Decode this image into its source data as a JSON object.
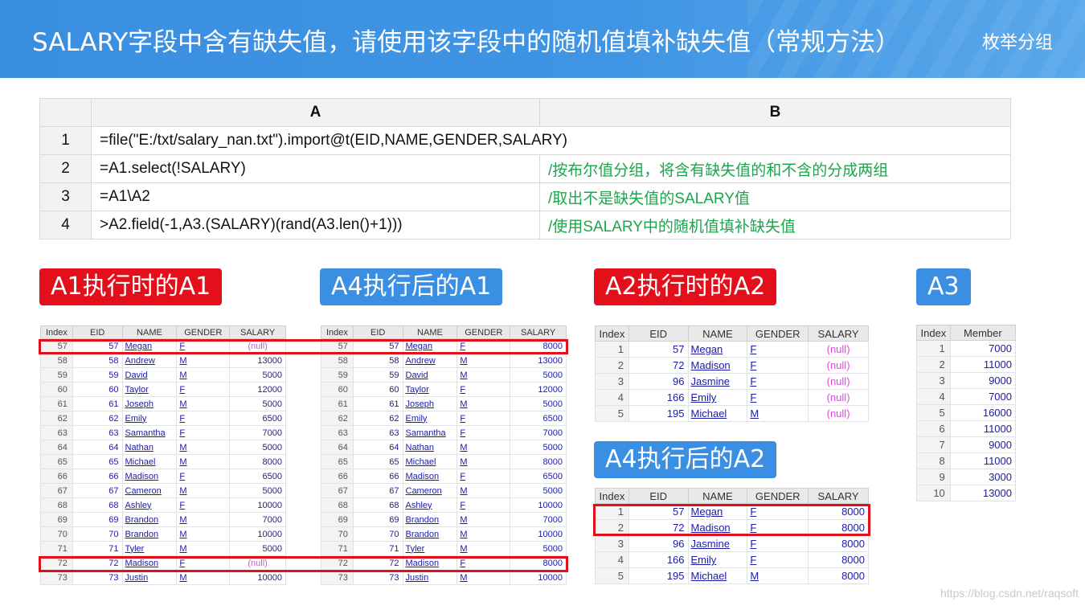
{
  "header": {
    "title": "SALARY字段中含有缺失值，请使用该字段中的随机值填补缺失值（常规方法）",
    "tag": "枚举分组"
  },
  "code_table": {
    "col_a": "A",
    "col_b": "B",
    "rows": [
      {
        "n": "1",
        "a": "=file(\"E:/txt/salary_nan.txt\").import@t(EID,NAME,GENDER,SALARY)",
        "b": ""
      },
      {
        "n": "2",
        "a": "=A1.select(!SALARY)",
        "b": "/按布尔值分组，将含有缺失值的和不含的分成两组"
      },
      {
        "n": "3",
        "a": "=A1\\A2",
        "b": "/取出不是缺失值的SALARY值"
      },
      {
        "n": "4",
        "a": ">A2.field(-1,A3.(SALARY)(rand(A3.len()+1)))",
        "b": "/使用SALARY中的随机值填补缺失值"
      }
    ]
  },
  "labels": {
    "a1_exec": "A1执行时的A1",
    "a4_after_a1": "A4执行后的A1",
    "a2_exec": "A2执行时的A2",
    "a3": "A3",
    "a4_after_a2": "A4执行后的A2"
  },
  "columns": {
    "index": "Index",
    "eid": "EID",
    "name": "NAME",
    "gender": "GENDER",
    "salary": "SALARY",
    "member": "Member"
  },
  "table_a1_before": [
    [
      "57",
      "57",
      "Megan",
      "F",
      "(null)"
    ],
    [
      "58",
      "58",
      "Andrew",
      "M",
      "13000"
    ],
    [
      "59",
      "59",
      "David",
      "M",
      "5000"
    ],
    [
      "60",
      "60",
      "Taylor",
      "F",
      "12000"
    ],
    [
      "61",
      "61",
      "Joseph",
      "M",
      "5000"
    ],
    [
      "62",
      "62",
      "Emily",
      "F",
      "6500"
    ],
    [
      "63",
      "63",
      "Samantha",
      "F",
      "7000"
    ],
    [
      "64",
      "64",
      "Nathan",
      "M",
      "5000"
    ],
    [
      "65",
      "65",
      "Michael",
      "M",
      "8000"
    ],
    [
      "66",
      "66",
      "Madison",
      "F",
      "6500"
    ],
    [
      "67",
      "67",
      "Cameron",
      "M",
      "5000"
    ],
    [
      "68",
      "68",
      "Ashley",
      "F",
      "10000"
    ],
    [
      "69",
      "69",
      "Brandon",
      "M",
      "7000"
    ],
    [
      "70",
      "70",
      "Brandon",
      "M",
      "10000"
    ],
    [
      "71",
      "71",
      "Tyler",
      "M",
      "5000"
    ],
    [
      "72",
      "72",
      "Madison",
      "F",
      "(null)"
    ],
    [
      "73",
      "73",
      "Justin",
      "M",
      "10000"
    ]
  ],
  "table_a1_after": [
    [
      "57",
      "57",
      "Megan",
      "F",
      "8000"
    ],
    [
      "58",
      "58",
      "Andrew",
      "M",
      "13000"
    ],
    [
      "59",
      "59",
      "David",
      "M",
      "5000"
    ],
    [
      "60",
      "60",
      "Taylor",
      "F",
      "12000"
    ],
    [
      "61",
      "61",
      "Joseph",
      "M",
      "5000"
    ],
    [
      "62",
      "62",
      "Emily",
      "F",
      "6500"
    ],
    [
      "63",
      "63",
      "Samantha",
      "F",
      "7000"
    ],
    [
      "64",
      "64",
      "Nathan",
      "M",
      "5000"
    ],
    [
      "65",
      "65",
      "Michael",
      "M",
      "8000"
    ],
    [
      "66",
      "66",
      "Madison",
      "F",
      "6500"
    ],
    [
      "67",
      "67",
      "Cameron",
      "M",
      "5000"
    ],
    [
      "68",
      "68",
      "Ashley",
      "F",
      "10000"
    ],
    [
      "69",
      "69",
      "Brandon",
      "M",
      "7000"
    ],
    [
      "70",
      "70",
      "Brandon",
      "M",
      "10000"
    ],
    [
      "71",
      "71",
      "Tyler",
      "M",
      "5000"
    ],
    [
      "72",
      "72",
      "Madison",
      "F",
      "8000"
    ],
    [
      "73",
      "73",
      "Justin",
      "M",
      "10000"
    ]
  ],
  "table_a2_before": [
    [
      "1",
      "57",
      "Megan",
      "F",
      "(null)"
    ],
    [
      "2",
      "72",
      "Madison",
      "F",
      "(null)"
    ],
    [
      "3",
      "96",
      "Jasmine",
      "F",
      "(null)"
    ],
    [
      "4",
      "166",
      "Emily",
      "F",
      "(null)"
    ],
    [
      "5",
      "195",
      "Michael",
      "M",
      "(null)"
    ]
  ],
  "table_a2_after": [
    [
      "1",
      "57",
      "Megan",
      "F",
      "8000"
    ],
    [
      "2",
      "72",
      "Madison",
      "F",
      "8000"
    ],
    [
      "3",
      "96",
      "Jasmine",
      "F",
      "8000"
    ],
    [
      "4",
      "166",
      "Emily",
      "F",
      "8000"
    ],
    [
      "5",
      "195",
      "Michael",
      "M",
      "8000"
    ]
  ],
  "table_a3": [
    [
      "1",
      "7000"
    ],
    [
      "2",
      "11000"
    ],
    [
      "3",
      "9000"
    ],
    [
      "4",
      "7000"
    ],
    [
      "5",
      "16000"
    ],
    [
      "6",
      "11000"
    ],
    [
      "7",
      "9000"
    ],
    [
      "8",
      "11000"
    ],
    [
      "9",
      "3000"
    ],
    [
      "10",
      "13000"
    ]
  ],
  "watermark": "https://blog.csdn.net/raqsoft"
}
